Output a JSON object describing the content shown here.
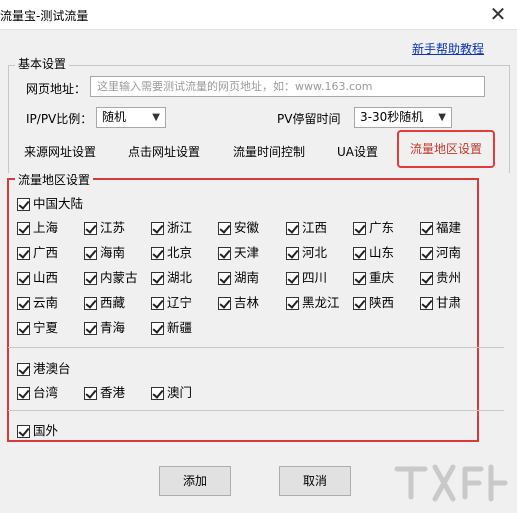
{
  "window": {
    "title": "流量宝-测试流量",
    "close_glyph": "✕"
  },
  "help_link": "新手帮助教程",
  "basic": {
    "caption": "基本设置",
    "url_label": "网页地址：",
    "url_placeholder": "这里输入需要测试流量的网页地址，如：www.163.com",
    "ratio_label": "IP/PV比例：",
    "ratio_value": "随机",
    "stay_label": "PV停留时间",
    "stay_value": "3-30秒随机"
  },
  "tabs": [
    "来源网址设置",
    "点击网址设置",
    "流量时间控制",
    "UA设置",
    "流量地区设置"
  ],
  "region": {
    "caption": "流量地区设置",
    "mainland": "中国大陆",
    "provinces": [
      [
        "上海",
        "江苏",
        "浙江",
        "安徽",
        "江西",
        "广东",
        "福建"
      ],
      [
        "广西",
        "海南",
        "北京",
        "天津",
        "河北",
        "山东",
        "河南"
      ],
      [
        "山西",
        "内蒙古",
        "湖北",
        "湖南",
        "四川",
        "重庆",
        "贵州"
      ],
      [
        "云南",
        "西藏",
        "辽宁",
        "吉林",
        "黑龙江",
        "陕西",
        "甘肃"
      ],
      [
        "宁夏",
        "青海",
        "新疆"
      ]
    ],
    "hmt": "港澳台",
    "hmt_items": [
      "台湾",
      "香港",
      "澳门"
    ],
    "foreign": "国外"
  },
  "buttons": {
    "add": "添加",
    "cancel": "取消"
  },
  "colors": {
    "highlight": "#d83a3a",
    "link": "#0b33b5"
  }
}
